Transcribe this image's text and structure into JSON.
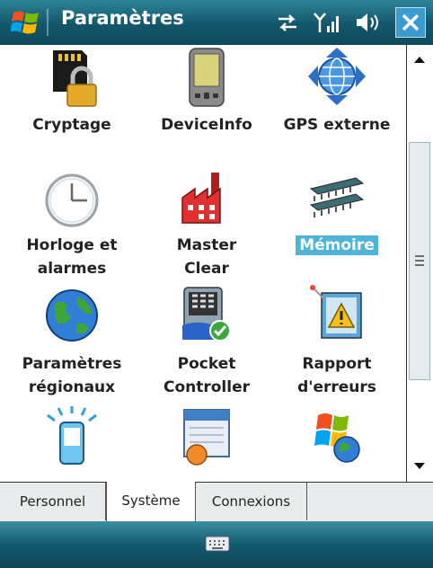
{
  "window": {
    "title": "Paramètres"
  },
  "items": [
    {
      "label": "Cryptage",
      "icon": "sd-card-lock-icon"
    },
    {
      "label": "DeviceInfo",
      "icon": "pda-device-icon"
    },
    {
      "label": "GPS externe",
      "icon": "gps-globe-icon"
    },
    {
      "label1": "Horloge et",
      "label2": "alarmes",
      "icon": "clock-icon"
    },
    {
      "label1": "Master",
      "label2": "Clear",
      "icon": "factory-icon"
    },
    {
      "label": "Mémoire",
      "icon": "memory-chip-icon",
      "selected": true
    },
    {
      "label1": "Paramètres",
      "label2": "régionaux",
      "icon": "globe-icon"
    },
    {
      "label1": "Pocket",
      "label2": "Controller",
      "icon": "pocket-controller-icon"
    },
    {
      "label1": "Rapport",
      "label2": "d'erreurs",
      "icon": "error-report-icon"
    },
    {
      "icon": "phone-light-icon"
    },
    {
      "icon": "calendar-icon"
    },
    {
      "icon": "windows-logo-icon"
    }
  ],
  "tabs": [
    {
      "label": "Personnel"
    },
    {
      "label": "Système",
      "active": true
    },
    {
      "label": "Connexions"
    }
  ],
  "colors": {
    "title_bar": "#13566a",
    "selection": "#4fb4d6",
    "close_button": "#3a9bd0"
  }
}
